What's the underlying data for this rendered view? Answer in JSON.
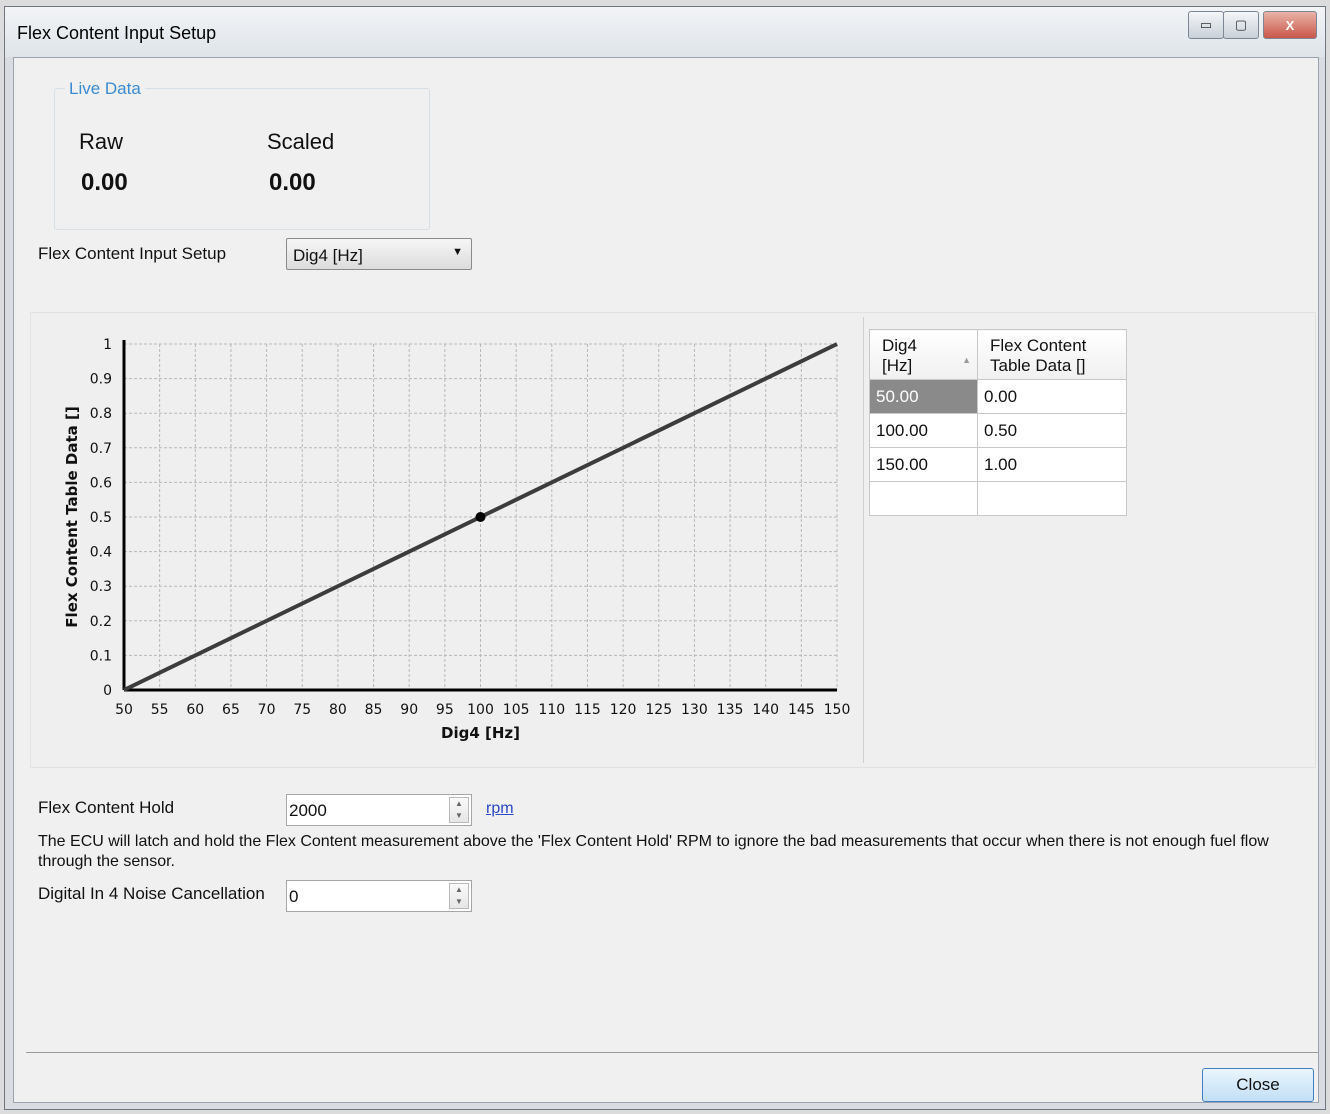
{
  "window": {
    "title": "Flex Content Input Setup",
    "controls": {
      "minimize": "▭",
      "maximize": "▢",
      "close": "X"
    }
  },
  "live_data": {
    "legend": "Live Data",
    "raw_label": "Raw",
    "raw_value": "0.00",
    "scaled_label": "Scaled",
    "scaled_value": "0.00"
  },
  "input_setup": {
    "label": "Flex Content Input Setup",
    "selected": "Dig4 [Hz]"
  },
  "chart_data": {
    "type": "line",
    "xlabel": "Dig4 [Hz]",
    "ylabel": "Flex Content Table Data []",
    "xlim": [
      50,
      150
    ],
    "ylim": [
      0,
      1
    ],
    "xticks": [
      50,
      55,
      60,
      65,
      70,
      75,
      80,
      85,
      90,
      95,
      100,
      105,
      110,
      115,
      120,
      125,
      130,
      135,
      140,
      145,
      150
    ],
    "yticks": [
      "0",
      "0.1",
      "0.2",
      "0.3",
      "0.4",
      "0.5",
      "0.6",
      "0.7",
      "0.8",
      "0.9",
      "1"
    ],
    "grid": true,
    "series": [
      {
        "x": [
          50,
          100,
          150
        ],
        "y": [
          0,
          0.5,
          1
        ]
      }
    ],
    "marker": {
      "x": 100,
      "y": 0.5
    },
    "colors": {
      "line": "#3c3c3c",
      "grid": "#b8b8b8",
      "axis": "#000000"
    }
  },
  "table": {
    "headers": [
      [
        "Dig4",
        "[Hz]"
      ],
      [
        "Flex Content",
        "Table Data []"
      ]
    ],
    "sort_icon": "sort-up-icon",
    "rows": [
      [
        "50.00",
        "0.00"
      ],
      [
        "100.00",
        "0.50"
      ],
      [
        "150.00",
        "1.00"
      ],
      [
        "",
        ""
      ]
    ]
  },
  "hold": {
    "label": "Flex Content Hold",
    "value": "2000",
    "unit_link": "rpm",
    "description": "The ECU will latch and hold the Flex Content measurement above the 'Flex Content Hold' RPM to ignore the bad measurements that occur when there is not enough fuel flow through the sensor."
  },
  "noise": {
    "label": "Digital In 4 Noise Cancellation",
    "value": "0"
  },
  "footer": {
    "close_label": "Close"
  }
}
